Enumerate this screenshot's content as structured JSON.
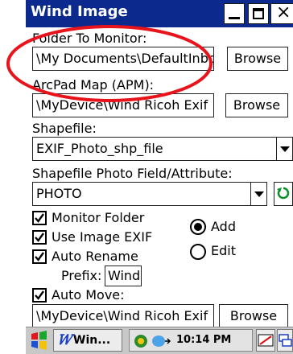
{
  "window": {
    "title": "Wind Image"
  },
  "title_buttons": {
    "close": "×"
  },
  "folder_to_monitor": {
    "label": "Folder To Monitor:",
    "value": "\\My Documents\\DefaultInbo",
    "browse": "Browse"
  },
  "arcpad_map": {
    "label": "ArcPad Map (APM):",
    "value": "\\MyDevice\\Wind Ricoh Exif",
    "browse": "Browse"
  },
  "shapefile": {
    "label": "Shapefile:",
    "value": "EXIF_Photo_shp_file"
  },
  "photo_field": {
    "label": "Shapefile Photo Field/Attribute:",
    "value": "PHOTO"
  },
  "options": {
    "monitor_folder": "Monitor Folder",
    "use_image_exif": "Use Image EXIF",
    "auto_rename": "Auto Rename",
    "prefix_label": "Prefix:",
    "prefix_value": "Wind",
    "auto_move": "Auto Move:"
  },
  "mode": {
    "add": "Add",
    "edit": "Edit",
    "selected": "Add"
  },
  "move_target": {
    "value": "\\MyDevice\\Wind Ricoh Exif",
    "browse": "Browse"
  },
  "taskbar": {
    "task_label": "Win...",
    "time": "10:14 PM"
  },
  "colors": {
    "titlebar": "#0c2a8e",
    "annotation_ellipse": "#e8141c"
  }
}
